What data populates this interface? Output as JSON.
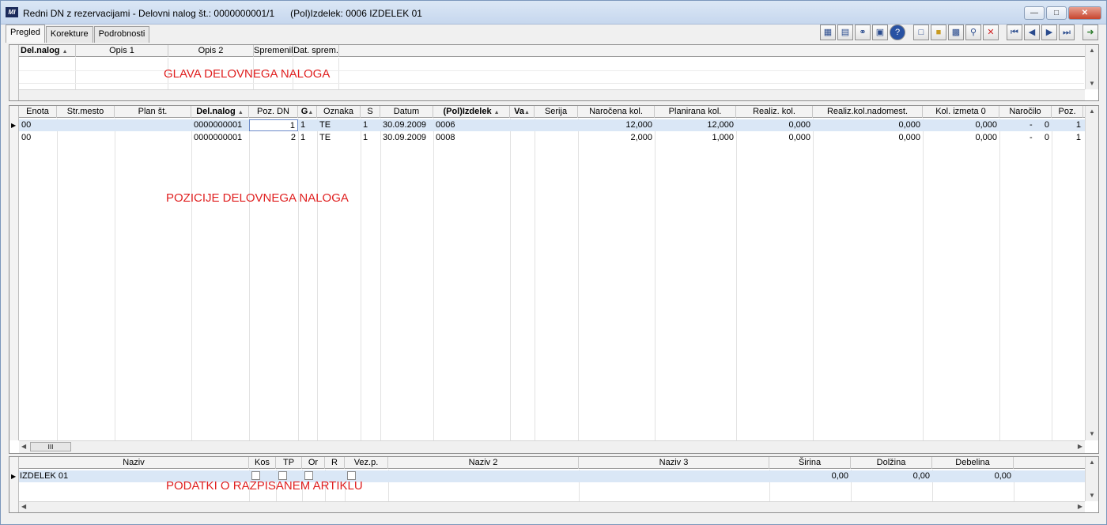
{
  "window": {
    "title": "Redni DN z rezervacijami - Delovni nalog št.: 0000000001/1      (Pol)Izdelek: 0006 IZDELEK 01"
  },
  "tabs": [
    {
      "label": "Pregled",
      "active": true
    },
    {
      "label": "Korekture",
      "active": false
    },
    {
      "label": "Podrobnosti",
      "active": false
    }
  ],
  "toolbar_icons": [
    "report-icon",
    "print-list-icon",
    "attach-icon",
    "display-icon",
    "help-icon",
    "new-icon",
    "open-icon",
    "print-icon",
    "search-icon",
    "delete-icon",
    "first-icon",
    "prev-icon",
    "next-icon",
    "last-icon",
    "exit-icon"
  ],
  "header_grid": {
    "columns": [
      "Del.nalog",
      "Opis 1",
      "Opis 2",
      "Spremenil",
      "Dat. sprem."
    ],
    "overlay": "GLAVA DELOVNEGA NALOGA"
  },
  "positions_grid": {
    "columns": [
      "Enota",
      "Str.mesto",
      "Plan št.",
      "Del.nalog",
      "Poz. DN",
      "G",
      "Oznaka",
      "S",
      "Datum",
      "(Pol)Izdelek",
      "Va",
      "Serija",
      "Naročena kol.",
      "Planirana kol.",
      "Realiz. kol.",
      "Realiz.kol.nadomest.",
      "Kol. izmeta 0",
      "Naročilo",
      "Poz."
    ],
    "rows": [
      [
        "00",
        "",
        "",
        "0000000001",
        "1",
        "1",
        "TE",
        "1",
        "30.09.2009",
        "0006",
        "",
        "",
        "12,000",
        "12,000",
        "0,000",
        "0,000",
        "0,000",
        "-     0",
        "1"
      ],
      [
        "00",
        "",
        "",
        "0000000001",
        "2",
        "1",
        "TE",
        "1",
        "30.09.2009",
        "0008",
        "",
        "",
        "2,000",
        "1,000",
        "0,000",
        "0,000",
        "0,000",
        "-     0",
        "1"
      ]
    ],
    "overlay": "POZICIJE DELOVNEGA NALOGA",
    "scroll_thumb": "III"
  },
  "article_grid": {
    "columns": [
      "Naziv",
      "Kos",
      "TP",
      "Or",
      "R",
      "Vez.p.",
      "Naziv 2",
      "Naziv 3",
      "Širina",
      "Dolžina",
      "Debelina"
    ],
    "row": {
      "naziv": "IZDELEK 01",
      "sirina": "0,00",
      "dolzina": "0,00",
      "debelina": "0,00"
    },
    "overlay": "PODATKI O RAZPISANEM ARTIKLU"
  }
}
